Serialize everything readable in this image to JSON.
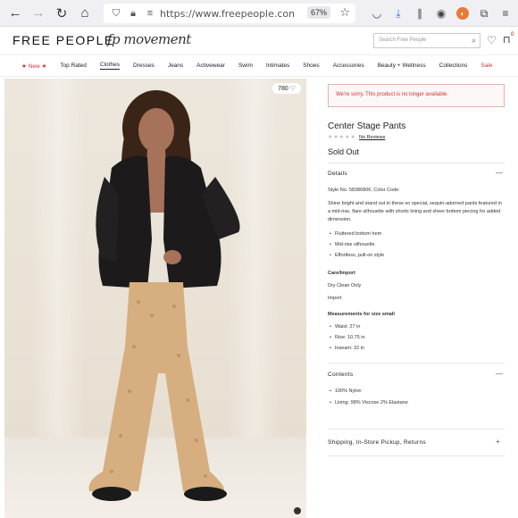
{
  "browser": {
    "url": "https://www.freepeople.com/sho",
    "zoom": "67%"
  },
  "site": {
    "logo": "FREE PEOPLE",
    "sub_brand": "fp movement",
    "search_placeholder": "Search Free People",
    "bag_count": "0"
  },
  "nav": {
    "items": [
      {
        "label": "★ New ★",
        "style": "red"
      },
      {
        "label": "Top Rated",
        "style": ""
      },
      {
        "label": "Clothes",
        "style": "active"
      },
      {
        "label": "Dresses",
        "style": ""
      },
      {
        "label": "Jeans",
        "style": ""
      },
      {
        "label": "Activewear",
        "style": ""
      },
      {
        "label": "Swim",
        "style": ""
      },
      {
        "label": "Intimates",
        "style": ""
      },
      {
        "label": "Shoes",
        "style": ""
      },
      {
        "label": "Accessories",
        "style": ""
      },
      {
        "label": "Beauty + Wellness",
        "style": ""
      },
      {
        "label": "Collections",
        "style": ""
      },
      {
        "label": "Sale",
        "style": "red"
      }
    ]
  },
  "product": {
    "likes": "780 ♡",
    "alert": "We're sorry. This product is no longer available.",
    "title": "Center Stage Pants",
    "stars": "★★★★★",
    "reviews": "No Reviews",
    "status": "Sold Out",
    "details_label": "Details",
    "style_line": "Style No. 58386806; Color Code:",
    "description": "Shine bright and stand out in these so special, sequin-adorned pants featured in a mid-rise, flare silhouette with shorts lining and sheer bottom piecing for added dimension.",
    "features": [
      "Fluttered bottom hem",
      "Mid-rise silhouette",
      "Effortless, pull-on style"
    ],
    "care_label": "Care/Import",
    "care": "Dry Clean Only",
    "import": "Import",
    "measure_label": "Measurements for size small",
    "measurements": [
      "Waist: 27 in",
      "Rise: 10.75 in",
      "Inseam: 32 in"
    ],
    "contents_label": "Contents",
    "contents": [
      "100% Nylon",
      "Lining: 98% Viscose 2% Elastane"
    ],
    "shipping_label": "Shipping, In-Store Pickup, Returns"
  },
  "colors": {
    "sale_red": "#c33",
    "alert_border": "#e3b1b1"
  }
}
